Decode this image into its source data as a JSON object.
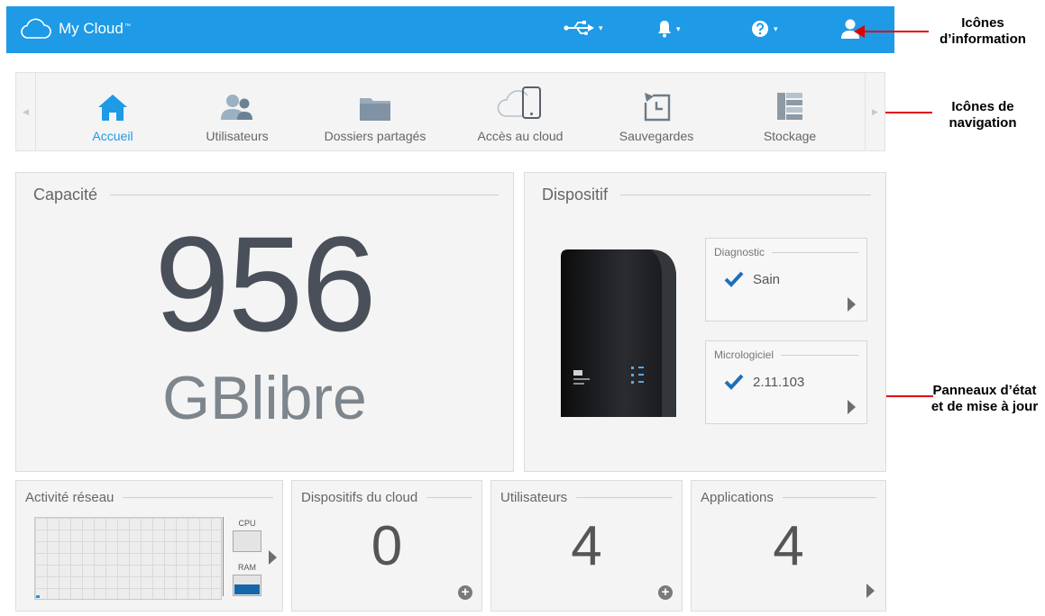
{
  "app": {
    "title": "My Cloud",
    "trademark": "™"
  },
  "topbar": {
    "icons": [
      "usb-icon",
      "bell-icon",
      "help-icon",
      "user-icon"
    ],
    "caret": "▾",
    "accent": "#1e9ae6"
  },
  "nav": {
    "items": [
      {
        "label": "Accueil",
        "icon": "home-icon",
        "active": true
      },
      {
        "label": "Utilisateurs",
        "icon": "users-icon",
        "active": false
      },
      {
        "label": "Dossiers partagés",
        "icon": "folder-icon",
        "active": false
      },
      {
        "label": "Accès au cloud",
        "icon": "cloud-device-icon",
        "active": false
      },
      {
        "label": "Sauvegardes",
        "icon": "backup-icon",
        "active": false
      },
      {
        "label": "Stockage",
        "icon": "storage-icon",
        "active": false
      }
    ],
    "left_arrow": "◀",
    "right_arrow": "▶"
  },
  "capacity": {
    "title": "Capacité",
    "value": "956",
    "unit": "GBlibre"
  },
  "device": {
    "title": "Dispositif",
    "image": "nas-device-image",
    "diagnostic": {
      "title": "Diagnostic",
      "value": "Sain"
    },
    "firmware": {
      "title": "Micrologiciel",
      "value": "2.11.103"
    }
  },
  "network": {
    "title": "Activité réseau",
    "cpu_label": "CPU",
    "ram_label": "RAM",
    "ram_usage": 0.5
  },
  "cloud_devices": {
    "title": "Dispositifs du cloud",
    "value": "0"
  },
  "users": {
    "title": "Utilisateurs",
    "value": "4"
  },
  "apps": {
    "title": "Applications",
    "value": "4"
  },
  "plus_symbol": "+",
  "annotations": {
    "info_icons": "Icônes d’information",
    "nav_icons": "Icônes de navigation",
    "status_panels": "Panneaux d’état et de mise à jour",
    "arrow_color": "#e00000"
  }
}
